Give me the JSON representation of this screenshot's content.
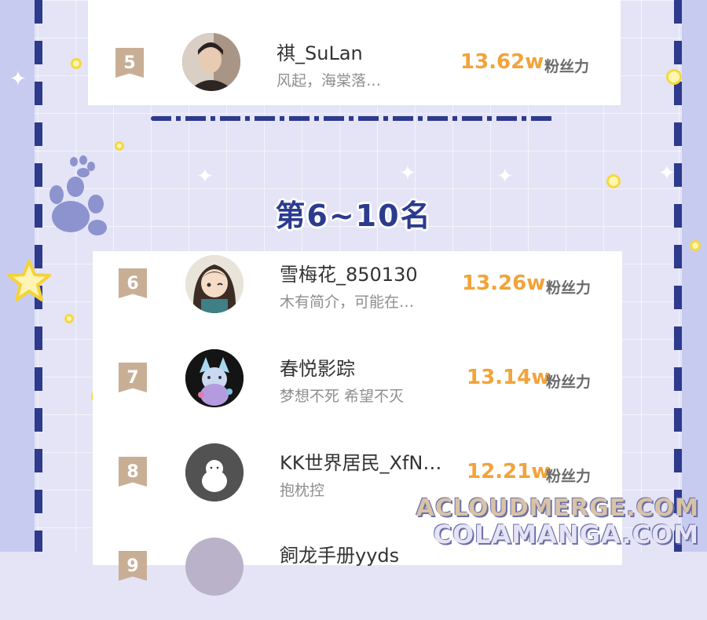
{
  "section_title": "第6~10名",
  "fans_label": "粉丝力",
  "rankings": [
    {
      "rank": "5",
      "name": "祺_SuLan",
      "bio": "风起，海棠落…",
      "fans": "13.62w"
    },
    {
      "rank": "6",
      "name": "雪梅花_850130",
      "bio": "木有简介，可能在…",
      "fans": "13.26w"
    },
    {
      "rank": "7",
      "name": "春悦影踪",
      "bio": "梦想不死  希望不灭",
      "fans": "13.14w"
    },
    {
      "rank": "8",
      "name": "KK世界居民_XfN…",
      "bio": "抱枕控",
      "fans": "12.21w"
    },
    {
      "rank": "9",
      "name": "飼龙手册yyds",
      "bio": "",
      "fans": ""
    }
  ],
  "watermark": {
    "line1": "ACLOUDMERGE.COM",
    "line2": "COLAMANGA.COM"
  },
  "colors": {
    "accent": "#f2a33a",
    "navy": "#2b3b8f",
    "rank_badge": "#c9ae96"
  }
}
